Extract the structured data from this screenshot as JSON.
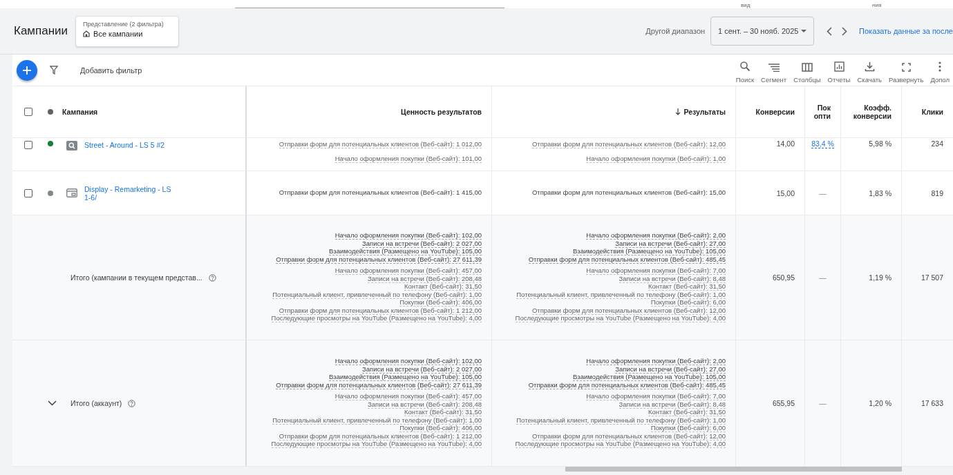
{
  "top_strip": {
    "texts": [
      "вид",
      "ния"
    ]
  },
  "header": {
    "title": "Кампании",
    "view": {
      "label": "Представление (2 фильтра)",
      "value": "Все кампании"
    },
    "range_label": "Другой диапазон",
    "date_range": "1 сент. – 30 нояб. 2025",
    "link": "Показать данные за после"
  },
  "toolbar": {
    "add_filter": "Добавить фильтр",
    "tools": [
      {
        "kind": "search",
        "label": "Поиск"
      },
      {
        "kind": "segment",
        "label": "Сегмент"
      },
      {
        "kind": "columns",
        "label": "Столбцы"
      },
      {
        "kind": "reports",
        "label": "Отчеты"
      },
      {
        "kind": "download",
        "label": "Скачать"
      },
      {
        "kind": "expand",
        "label": "Развернуть"
      },
      {
        "kind": "more",
        "label": "Допол"
      }
    ]
  },
  "table": {
    "all_selected": false,
    "columns": [
      {
        "label": "Кампания",
        "sorted": false
      },
      {
        "label": "Ценность результатов",
        "sorted": false
      },
      {
        "label": "Результаты",
        "sorted": true
      },
      {
        "label": "Конверсии",
        "sorted": false
      },
      {
        "label": "Пок опти",
        "sorted": false
      },
      {
        "label": "Коэфф. конверсии",
        "sorted": false
      },
      {
        "label": "Клики",
        "sorted": false
      }
    ],
    "rows": [
      {
        "selected": false,
        "color": "#188038",
        "kind": "search",
        "name": "Street - Around - LS 5 #2",
        "value": [
          {
            "kind": "dotted",
            "lines": [
              "Отправки форм для потенциальных клиентов (Веб-сайт): 1 012,00",
              "Начало оформления покупки (Веб-сайт): 101,00"
            ]
          }
        ],
        "results": [
          {
            "kind": "dotted",
            "lines": [
              "Отправки форм для потенциальных клиентов (Веб-сайт): 12,00",
              "Начало оформления покупки (Веб-сайт): 1,00"
            ]
          }
        ],
        "conversions": "14,00",
        "optimization": "83,4 %",
        "optimization_link": true,
        "conversion_rate": "5,98 %",
        "clicks": "234"
      },
      {
        "selected": false,
        "color": "#80868b",
        "kind": "display",
        "name": "Display - Remarketing - LS 1-6/",
        "value": [
          {
            "kind": "plain",
            "lines": [
              "Отправки форм для потенциальных клиентов (Веб-сайт): 1 415,00"
            ]
          }
        ],
        "results": [
          {
            "kind": "plain",
            "lines": [
              "Отправки форм для потенциальных клиентов (Веб-сайт): 15,00"
            ]
          }
        ],
        "conversions": "15,00",
        "optimization": "—",
        "optimization_link": false,
        "conversion_rate": "1,83 %",
        "clicks": "819"
      }
    ],
    "totals": [
      {
        "label": "Итого (кампании в текущем представ...",
        "has_toggle": false,
        "value": [
          {
            "kind": "strong",
            "lines": [
              "Начало оформления покупки (Веб-сайт): 102,00",
              "Записи на встречи (Веб-сайт): 2 027,00",
              "Взаимодействия (Размещено на YouTube): 105,00",
              "Отправки форм для потенциальных клиентов (Веб-сайт): 27 611,39"
            ]
          },
          {
            "kind": "dotted",
            "lines": [
              "Начало оформления покупки (Веб-сайт): 457,00",
              "Записи на встречи (Веб-сайт): 208,48",
              "Контакт (Веб-сайт): 31,50",
              "Потенциальный клиент, привлеченный по телефону (Веб-сайт): 1,00",
              "Покупки (Веб-сайт): 406,00",
              "Отправки форм для потенциальных клиентов (Веб-сайт): 1 212,00",
              "Последующие просмотры на YouTube (Размещено на YouTube): 4,00"
            ]
          }
        ],
        "results": [
          {
            "kind": "strong",
            "lines": [
              "Начало оформления покупки (Веб-сайт): 2,00",
              "Записи на встречи (Веб-сайт): 27,00",
              "Взаимодействия (Размещено на YouTube): 105,00",
              "Отправки форм для потенциальных клиентов (Веб-сайт): 485,45"
            ]
          },
          {
            "kind": "dotted",
            "lines": [
              "Начало оформления покупки (Веб-сайт): 7,00",
              "Записи на встречи (Веб-сайт): 8,48",
              "Контакт (Веб-сайт): 31,50",
              "Потенциальный клиент, привлеченный по телефону (Веб-сайт): 1,00",
              "Покупки (Веб-сайт): 6,00",
              "Отправки форм для потенциальных клиентов (Веб-сайт): 12,00",
              "Последующие просмотры на YouTube (Размещено на YouTube): 4,00"
            ]
          }
        ],
        "conversions": "650,95",
        "optimization": "—",
        "conversion_rate": "1,19 %",
        "clicks": "17 507"
      },
      {
        "label": "Итого (аккаунт)",
        "has_toggle": true,
        "value": [
          {
            "kind": "strong",
            "lines": [
              "Начало оформления покупки (Веб-сайт): 102,00",
              "Записи на встречи (Веб-сайт): 2 027,00",
              "Взаимодействия (Размещено на YouTube): 105,00",
              "Отправки форм для потенциальных клиентов (Веб-сайт): 27 611,39"
            ]
          },
          {
            "kind": "dotted",
            "lines": [
              "Начало оформления покупки (Веб-сайт): 457,00",
              "Записи на встречи (Веб-сайт): 208,48",
              "Контакт (Веб-сайт): 31,50",
              "Потенциальный клиент, привлеченный по телефону (Веб-сайт): 1,00",
              "Покупки (Веб-сайт): 406,00",
              "Отправки форм для потенциальных клиентов (Веб-сайт): 1 212,00",
              "Последующие просмотры на YouTube (Размещено на YouTube): 4,00"
            ]
          }
        ],
        "results": [
          {
            "kind": "strong",
            "lines": [
              "Начало оформления покупки (Веб-сайт): 2,00",
              "Записи на встречи (Веб-сайт): 27,00",
              "Взаимодействия (Размещено на YouTube): 105,00",
              "Отправки форм для потенциальных клиентов (Веб-сайт): 485,45"
            ]
          },
          {
            "kind": "dotted",
            "lines": [
              "Начало оформления покупки (Веб-сайт): 7,00",
              "Записи на встречи (Веб-сайт): 8,48",
              "Контакт (Веб-сайт): 31,50",
              "Потенциальный клиент, привлеченный по телефону (Веб-сайт): 1,00",
              "Покупки (Веб-сайт): 6,00",
              "Отправки форм для потенциальных клиентов (Веб-сайт): 12,00",
              "Последующие просмотры на YouTube (Размещено на YouTube): 4,00"
            ]
          }
        ],
        "conversions": "655,95",
        "optimization": "—",
        "conversion_rate": "1,20 %",
        "clicks": "17 633"
      }
    ]
  }
}
